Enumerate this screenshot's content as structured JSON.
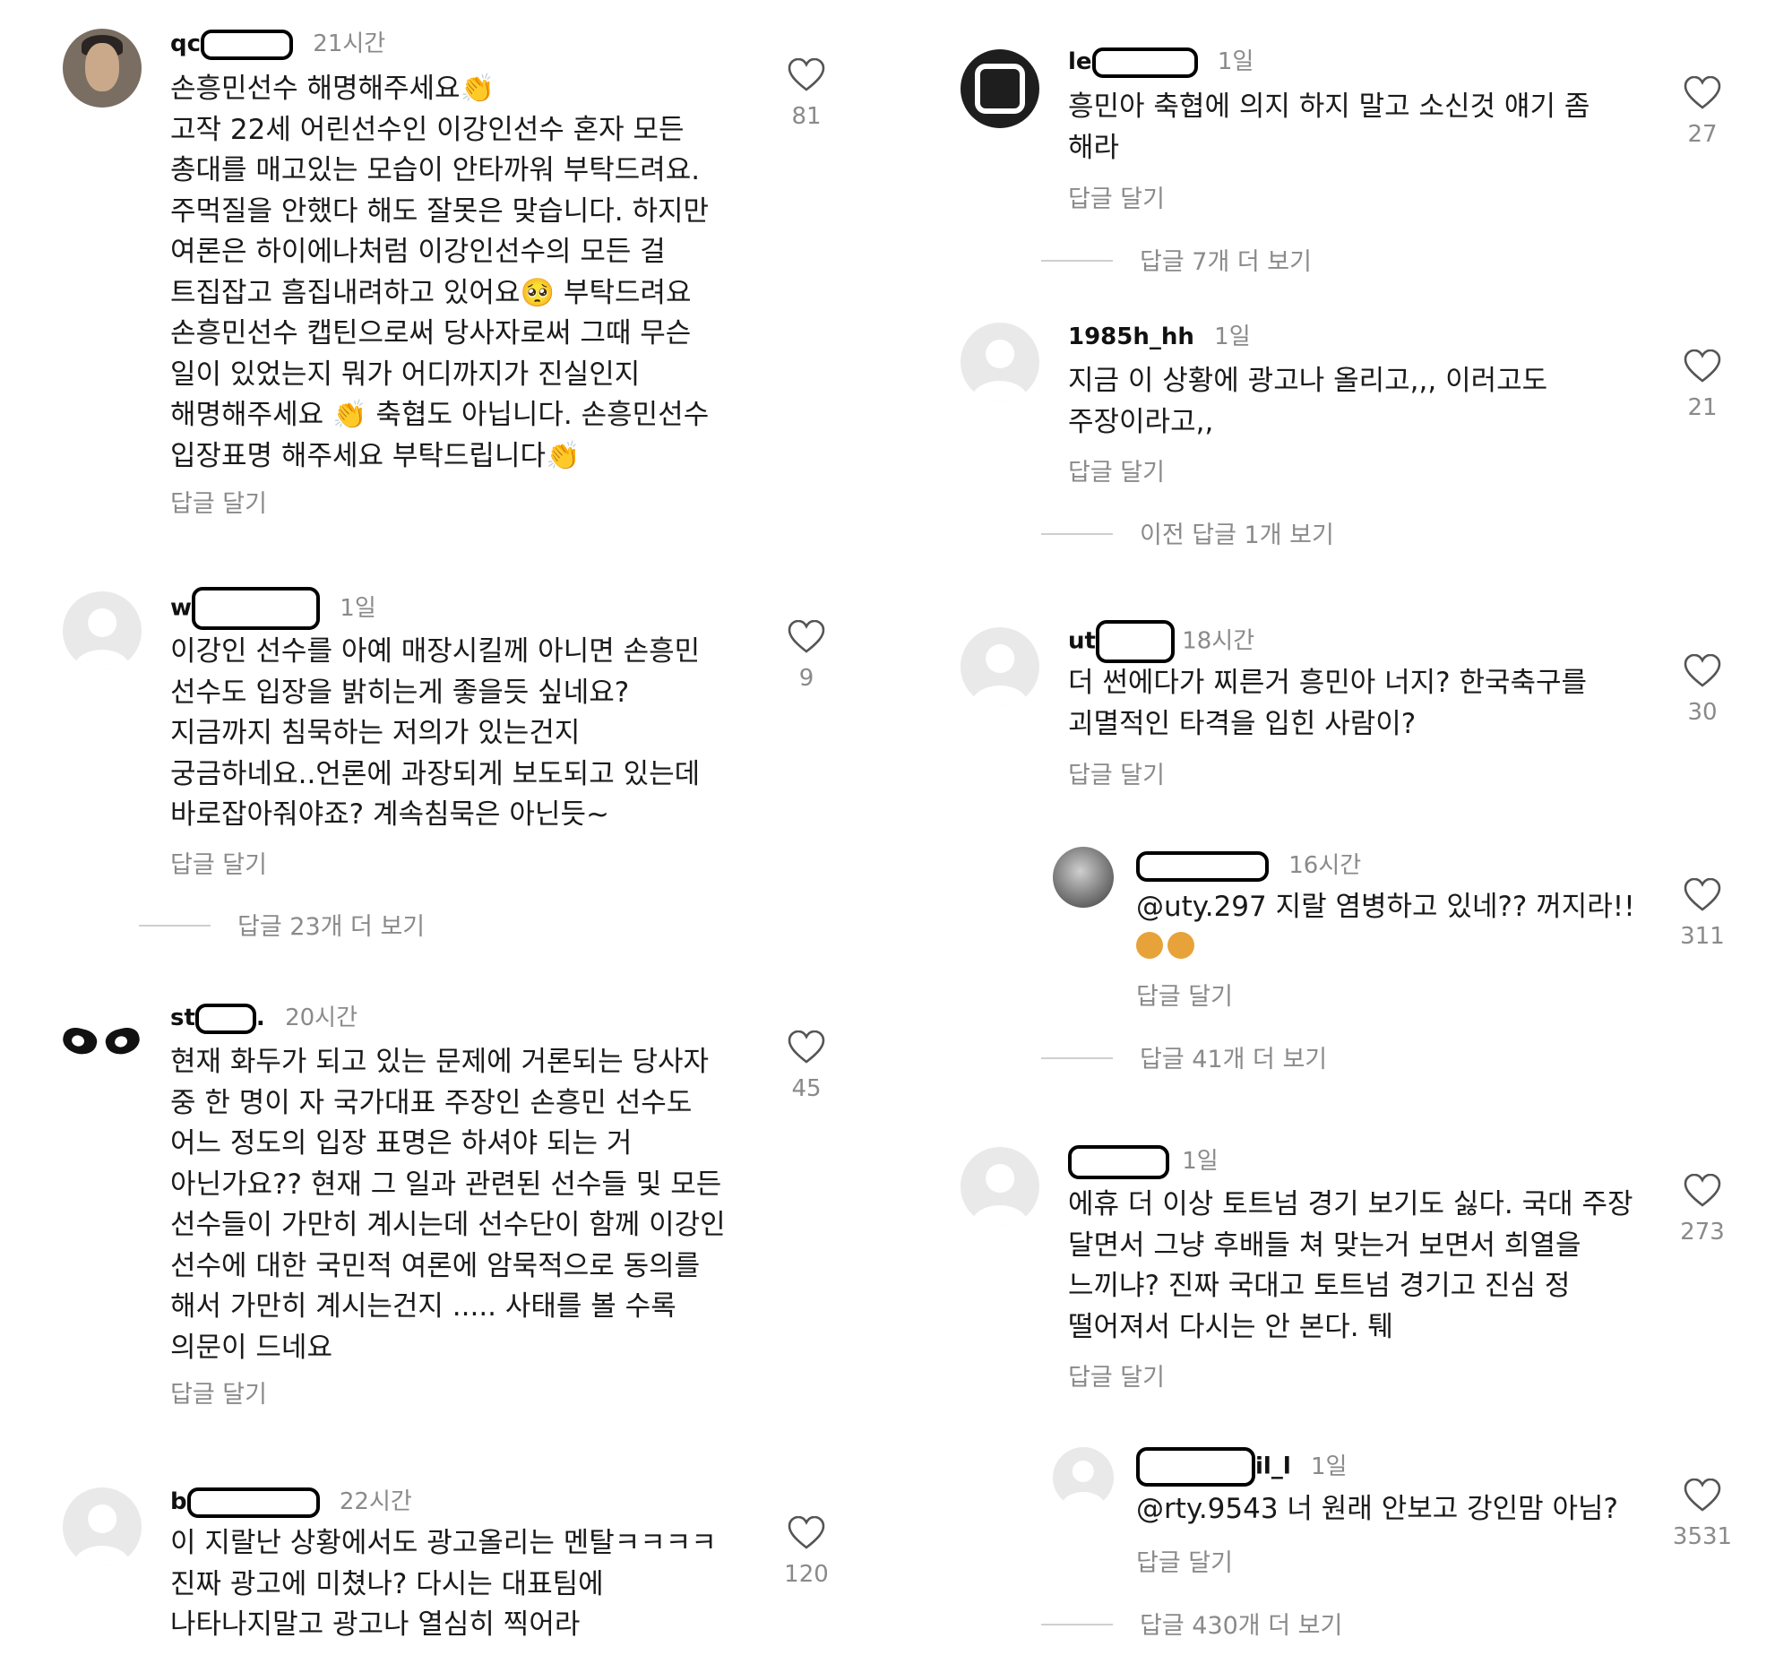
{
  "left_comments": [
    {
      "username": "qc",
      "time": "21시간",
      "likes": "81",
      "reply": "답글 달기",
      "text": "손흥민선수 해명해주세요👏\n고작 22세 어린선수인 이강인선수 혼자 모든\n총대를 매고있는 모습이 안타까워 부탁드려요.\n주먹질을 안했다 해도 잘못은 맞습니다. 하지만\n여론은 하이에나처럼 이강인선수의 모든 걸\n트집잡고 흠집내려하고 있어요🥺 부탁드려요\n손흥민선수 캡틴으로써 당사자로써 그때 무슨\n일이 있었는지 뭐가 어디까지가 진실인지\n해명해주세요 👏 축협도 아닙니다. 손흥민선수\n입장표명 해주세요 부탁드립니다👏"
    },
    {
      "username": "w",
      "time": "1일",
      "likes": "9",
      "reply": "답글 달기",
      "more": "답글 23개 더 보기",
      "text": "이강인 선수를 아예  매장시킬께 아니면 손흥민\n선수도 입장을 밝히는게 좋을듯 싶네요?\n지금까지 침묵하는 저의가 있는건지\n궁금하네요..언론에 과장되게 보도되고 있는데\n바로잡아줘야죠? 계속침묵은 아닌듯~"
    },
    {
      "username": "st",
      "username_suffix": ".",
      "time": "20시간",
      "likes": "45",
      "reply": "답글 달기",
      "text": "현재 화두가 되고 있는 문제에 거론되는 당사자\n중 한 명이 자 국가대표 주장인 손흥민 선수도\n어느 정도의 입장 표명은 하셔야 되는 거\n아닌가요?? 현재 그 일과 관련된 선수들 및 모든\n선수들이 가만히 계시는데 선수단이 함께 이강인\n선수에 대한 국민적 여론에 암묵적으로 동의를\n해서 가만히 계시는건지 ..... 사태를 볼 수록\n의문이 드네요"
    },
    {
      "username": "b",
      "time": "22시간",
      "likes": "120",
      "text": "이 지랄난 상황에서도 광고올리는 멘탈ㅋㅋㅋㅋ\n진짜 광고에 미쳤나? 다시는 대표팀에\n나타나지말고 광고나 열심히 찍어라"
    }
  ],
  "right_comments": [
    {
      "username": "le",
      "time": "1일",
      "likes": "27",
      "reply": "답글 달기",
      "more": "답글 7개 더 보기",
      "text": "흥민아 축협에 의지 하지 말고 소신것  얘기 좀\n해라"
    },
    {
      "username": "1985h_hh",
      "time": "1일",
      "likes": "21",
      "reply": "답글 달기",
      "more": "이전 답글 1개 보기",
      "text": "지금 이 상황에 광고나 올리고,,, 이러고도\n주장이라고,,"
    },
    {
      "username": "ut",
      "time": "18시간",
      "likes": "30",
      "reply": "답글 달기",
      "text": "더 썬에다가 찌른거 흥민아 너지? 한국축구를\n괴멸적인 타격을 입힌 사람이?"
    },
    {
      "username": "",
      "time": "16시간",
      "likes": "311",
      "reply": "답글 달기",
      "more": "답글 41개 더 보기",
      "text": "@uty.297 지랄 염병하고 있네?? 꺼지라!!"
    },
    {
      "username": "",
      "time": "1일",
      "likes": "273",
      "reply": "답글 달기",
      "text": "에휴 더 이상 토트넘 경기 보기도 싫다. 국대 주장\n달면서 그냥 후배들 쳐 맞는거 보면서 희열을\n느끼냐? 진짜 국대고 토트넘 경기고 진심 정\n떨어져서 다시는 안 본다. 퉤"
    },
    {
      "username": "",
      "username_suffix": "il_l",
      "time": "1일",
      "likes": "3531",
      "reply": "답글 달기",
      "more": "답글 430개 더 보기",
      "text": "@rty.9543 너 원래 안보고 강인맘 아님?"
    }
  ]
}
